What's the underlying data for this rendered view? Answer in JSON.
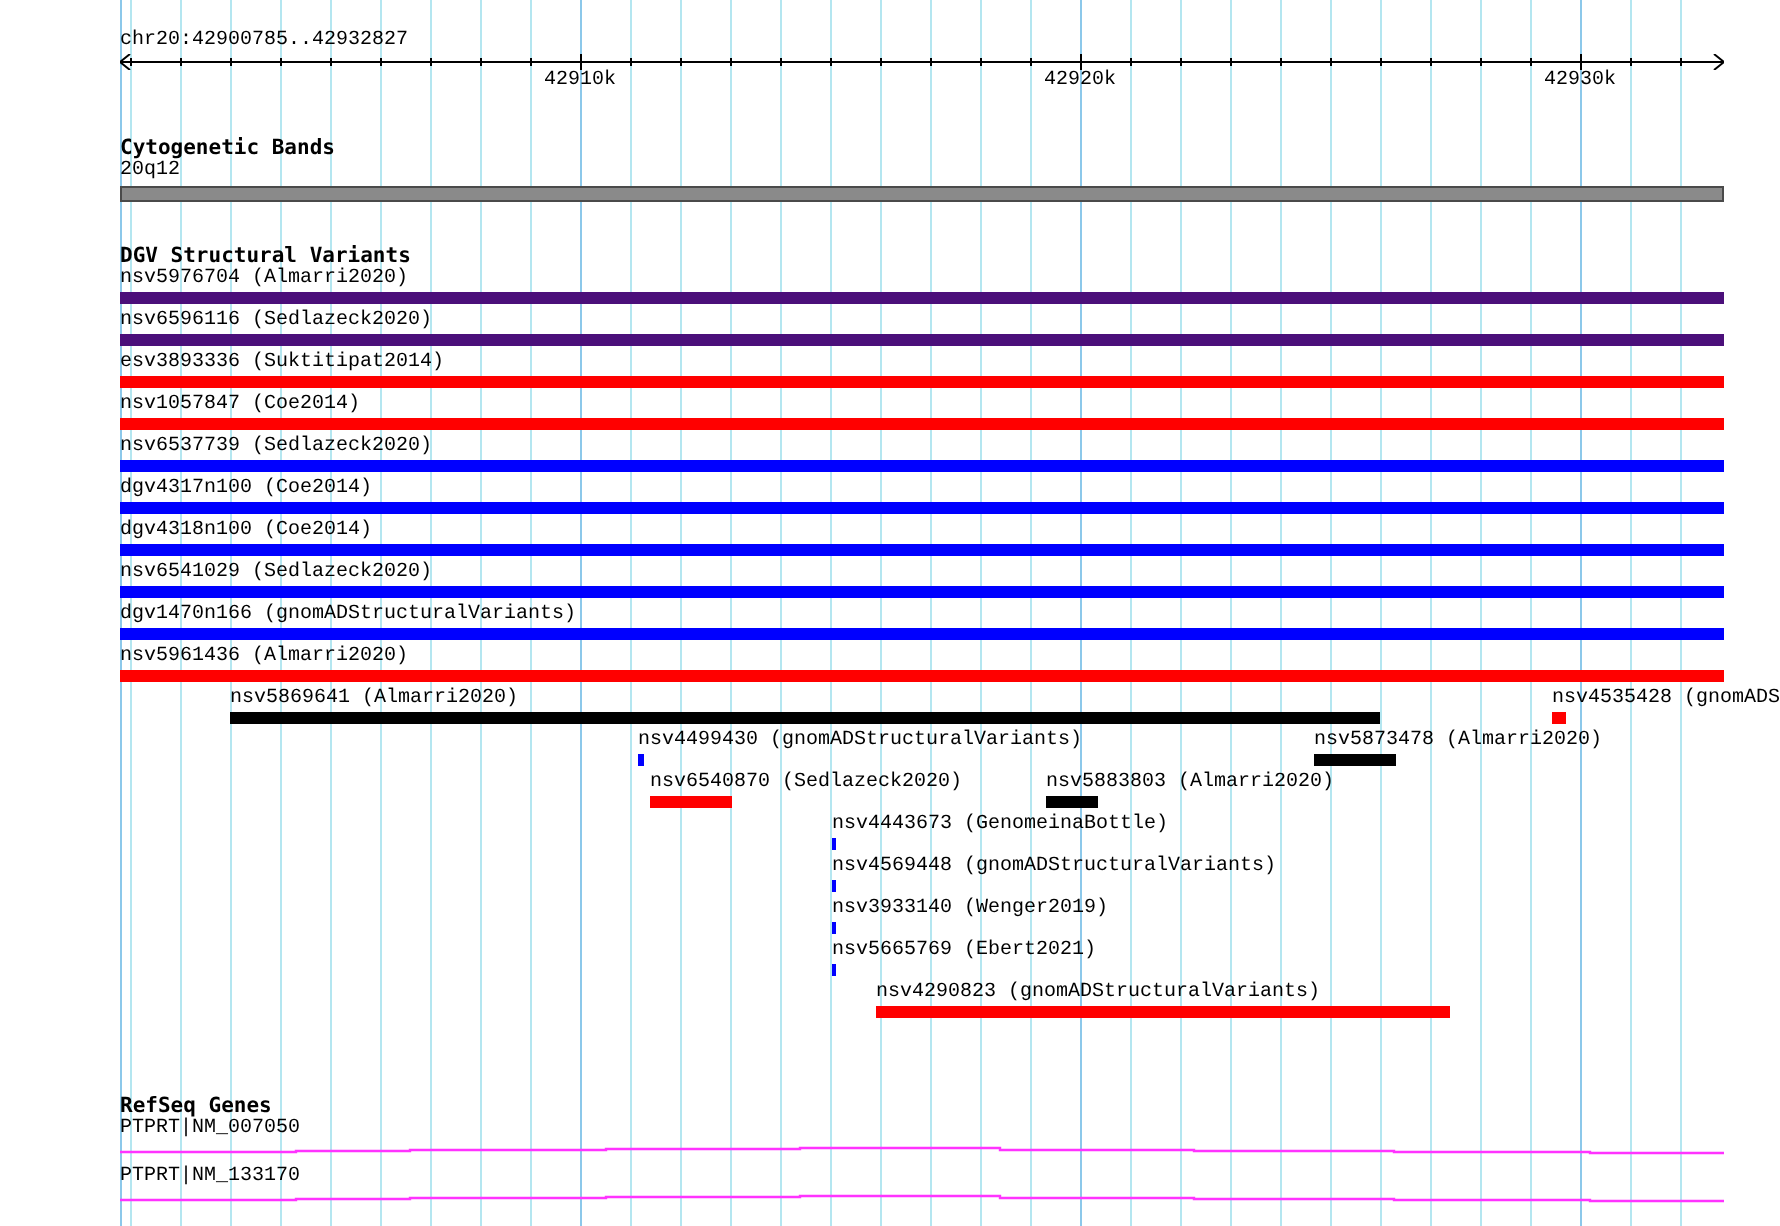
{
  "ruler": {
    "location": "chr20:42900785..42932827",
    "ticks": [
      "42910k",
      "42920k",
      "42930k"
    ]
  },
  "tracks": [
    {
      "kind": "bands",
      "title": "Cytogenetic Bands",
      "features": [
        {
          "label": "20q12"
        }
      ]
    },
    {
      "kind": "variants",
      "title": "DGV Structural Variants",
      "features": [
        {
          "label": "nsv5976704 (Almarri2020)",
          "color": "#4b0f7a"
        },
        {
          "label": "nsv6596116 (Sedlazeck2020)",
          "color": "#4b0f7a"
        },
        {
          "label": "esv3893336 (Suktitipat2014)",
          "color": "#ff0000"
        },
        {
          "label": "nsv1057847 (Coe2014)",
          "color": "#ff0000"
        },
        {
          "label": "nsv6537739 (Sedlazeck2020)",
          "color": "#0000ff"
        },
        {
          "label": "dgv4317n100 (Coe2014)",
          "color": "#0000ff"
        },
        {
          "label": "dgv4318n100 (Coe2014)",
          "color": "#0000ff"
        },
        {
          "label": "nsv6541029 (Sedlazeck2020)",
          "color": "#0000ff"
        },
        {
          "label": "dgv1470n166 (gnomADStructuralVariants)",
          "color": "#0000ff"
        },
        {
          "label": "nsv5961436 (Almarri2020)",
          "color": "#ff0000"
        },
        {
          "label": "nsv5869641 (Almarri2020)",
          "color": "#000000"
        },
        {
          "label": "nsv4535428 (gnomADS",
          "color": "#ff0000"
        },
        {
          "label": "nsv4499430 (gnomADStructuralVariants)",
          "color": "#0000ff"
        },
        {
          "label": "nsv5873478 (Almarri2020)",
          "color": "#000000"
        },
        {
          "label": "nsv6540870 (Sedlazeck2020)",
          "color": "#ff0000"
        },
        {
          "label": "nsv5883803 (Almarri2020)",
          "color": "#000000"
        },
        {
          "label": "nsv4443673 (GenomeinaBottle)",
          "color": "#0000ff"
        },
        {
          "label": "nsv4569448 (gnomADStructuralVariants)",
          "color": "#0000ff"
        },
        {
          "label": "nsv3933140 (Wenger2019)",
          "color": "#0000ff"
        },
        {
          "label": "nsv5665769 (Ebert2021)",
          "color": "#0000ff"
        },
        {
          "label": "nsv4290823 (gnomADStructuralVariants)",
          "color": "#ff0000"
        }
      ]
    },
    {
      "kind": "genes",
      "title": "RefSeq Genes",
      "features": [
        {
          "label": "PTPRT|NM_007050"
        },
        {
          "label": "PTPRT|NM_133170"
        }
      ]
    }
  ]
}
